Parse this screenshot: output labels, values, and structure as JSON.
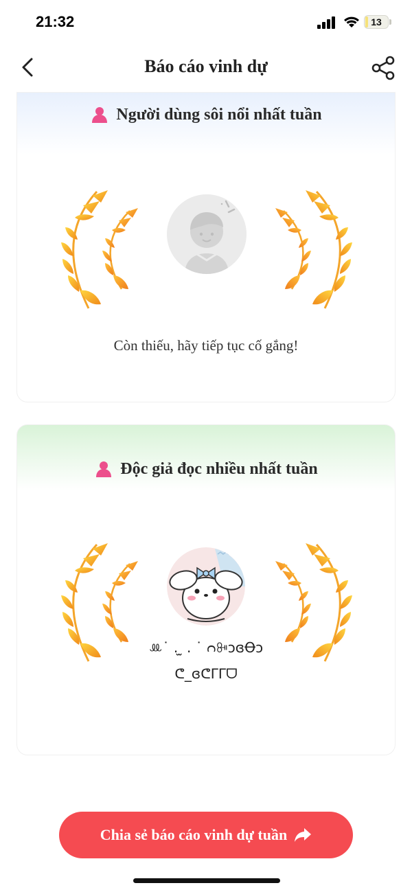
{
  "status_bar": {
    "time": "21:32",
    "battery_level": "13",
    "battery_fraction": 0.13,
    "icons": [
      "signal-icon",
      "wifi-icon",
      "battery-icon"
    ]
  },
  "header": {
    "title": "Báo cáo vinh dự",
    "back_icon": "chevron-left-icon",
    "share_icon": "share-icon"
  },
  "cards": [
    {
      "title": "Người dùng sôi nổi nhất tuần",
      "icon": "person-icon",
      "avatar": "placeholder-avatar",
      "message": "Còn thiếu, hãy tiếp tục cố gắng!"
    },
    {
      "title": "Độc giả đọc nhiều nhất tuần",
      "icon": "person-icon",
      "avatar": "user-avatar",
      "username_line1": "ꔛ˙ . ̫ . ˙ ᴒꔻᴐɞꝊᴐ",
      "username_line2": "ᕦ_ɞᕦᒥᒥᗜ"
    }
  ],
  "share_button": {
    "label": "Chia sẻ báo cáo vinh dự tuần",
    "icon": "forward-arrow-icon"
  },
  "colors": {
    "accent": "#f54b51",
    "icon_pink": "#ec4f8c",
    "laurel_gold": "#f7b52b",
    "laurel_orange": "#f08a1a"
  }
}
